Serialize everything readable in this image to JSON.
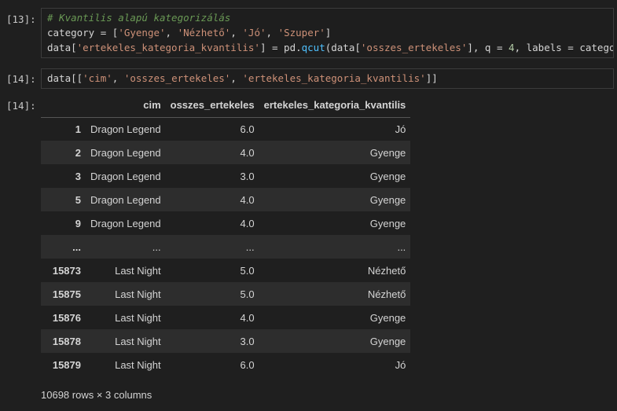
{
  "cell13": {
    "prompt": "[13]:",
    "comment": "# Kvantilis alapú kategorizálás",
    "line2_prefix": "category = [",
    "categories": [
      "'Gyenge'",
      "'Nézhető'",
      "'Jó'",
      "'Szuper'"
    ],
    "line3_a": "data[",
    "line3_key": "'ertekeles_kategoria_kvantilis'",
    "line3_b": "] = pd.",
    "line3_fn": "qcut",
    "line3_c": "(data[",
    "line3_key2": "'osszes_ertekeles'",
    "line3_d": "], q = ",
    "line3_num": "4",
    "line3_e": ", labels = category)"
  },
  "cell14": {
    "prompt": "[14]:",
    "code_a": "data[[",
    "cols": [
      "'cim'",
      "'osszes_ertekeles'",
      "'ertekeles_kategoria_kvantilis'"
    ],
    "code_b": "]]"
  },
  "output14": {
    "prompt": "[14]:",
    "headers": [
      "",
      "cim",
      "osszes_ertekeles",
      "ertekeles_kategoria_kvantilis"
    ],
    "rows": [
      [
        "1",
        "Dragon Legend",
        "6.0",
        "Jó"
      ],
      [
        "2",
        "Dragon Legend",
        "4.0",
        "Gyenge"
      ],
      [
        "3",
        "Dragon Legend",
        "3.0",
        "Gyenge"
      ],
      [
        "5",
        "Dragon Legend",
        "4.0",
        "Gyenge"
      ],
      [
        "9",
        "Dragon Legend",
        "4.0",
        "Gyenge"
      ],
      [
        "...",
        "...",
        "...",
        "..."
      ],
      [
        "15873",
        "Last Night",
        "5.0",
        "Nézhető"
      ],
      [
        "15875",
        "Last Night",
        "5.0",
        "Nézhető"
      ],
      [
        "15876",
        "Last Night",
        "4.0",
        "Gyenge"
      ],
      [
        "15878",
        "Last Night",
        "3.0",
        "Gyenge"
      ],
      [
        "15879",
        "Last Night",
        "6.0",
        "Jó"
      ]
    ],
    "shape": "10698 rows × 3 columns"
  }
}
